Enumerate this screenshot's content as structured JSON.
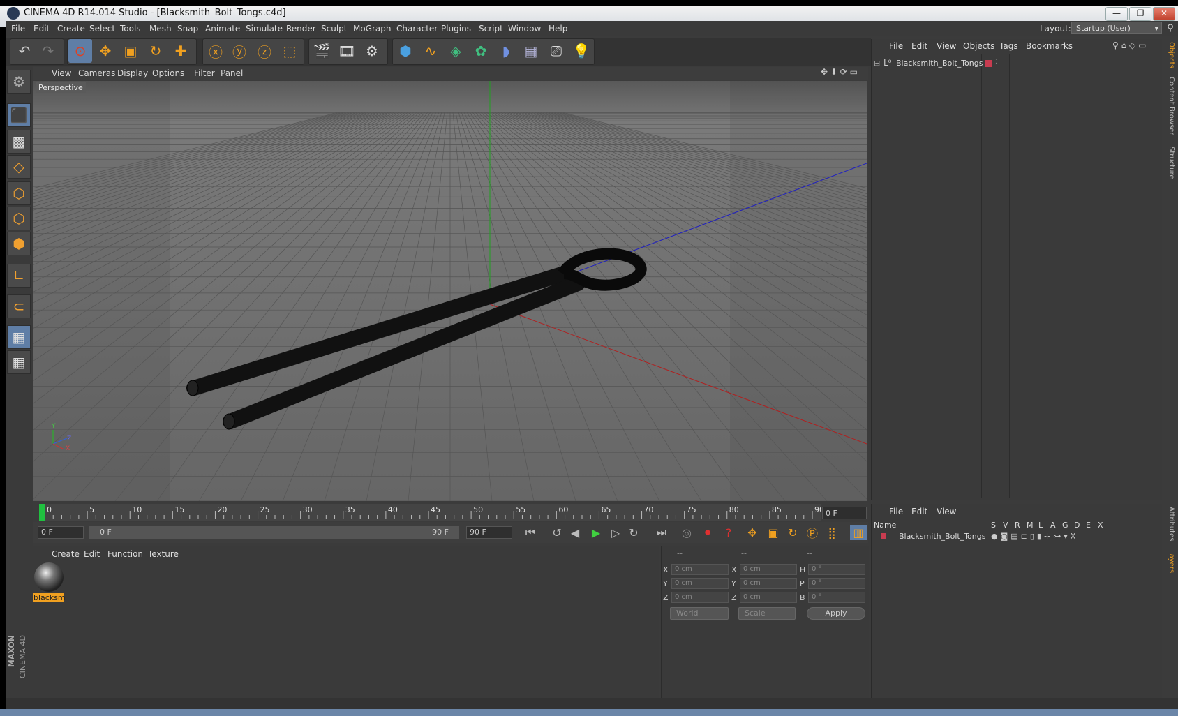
{
  "window": {
    "title": "CINEMA 4D R14.014 Studio - [Blacksmith_Bolt_Tongs.c4d]",
    "minimize": "—",
    "restore": "❐",
    "close": "✕"
  },
  "menubar": {
    "items": [
      "File",
      "Edit",
      "Create",
      "Select",
      "Tools",
      "Mesh",
      "Snap",
      "Animate",
      "Simulate",
      "Render",
      "Sculpt",
      "MoGraph",
      "Character",
      "Plugins",
      "Script",
      "Window",
      "Help"
    ],
    "layout_label": "Layout:",
    "layout_value": "Startup (User)"
  },
  "toolbar": {
    "icons": [
      "undo-icon",
      "redo-icon",
      "select-icon",
      "move-icon",
      "scale-icon",
      "rotate-icon",
      "add-icon",
      "x-axis-icon",
      "y-axis-icon",
      "z-axis-icon",
      "coordinate-system-icon",
      "render-view-icon",
      "render-picture-viewer-icon",
      "edit-render-settings-icon",
      "cube-icon",
      "spline-icon",
      "nurbs-icon",
      "mograph-cloner-icon",
      "deformer-icon",
      "floor-icon",
      "camera-icon",
      "light-icon"
    ]
  },
  "viewport": {
    "menu": [
      "View",
      "Cameras",
      "Display",
      "Options",
      "Filter",
      "Panel"
    ],
    "label": "Perspective",
    "axis_y": "Y",
    "axis_x": "X",
    "axis_z": "Z"
  },
  "timeline": {
    "ticks": [
      "0",
      "5",
      "10",
      "15",
      "20",
      "25",
      "30",
      "35",
      "40",
      "45",
      "50",
      "55",
      "60",
      "65",
      "70",
      "75",
      "80",
      "85",
      "90"
    ],
    "current_frame": "0 F",
    "start_field": "0 F",
    "range_start": "0 F",
    "range_end": "90 F",
    "end_field": "90 F"
  },
  "material_manager": {
    "menu": [
      "Create",
      "Edit",
      "Function",
      "Texture"
    ],
    "material_name": "blacksm"
  },
  "coordinates": {
    "headers": [
      "--",
      "--",
      "--"
    ],
    "rows": [
      {
        "a": "X",
        "av": "0 cm",
        "b": "X",
        "bv": "0 cm",
        "c": "H",
        "cv": "0 °"
      },
      {
        "a": "Y",
        "av": "0 cm",
        "b": "Y",
        "bv": "0 cm",
        "c": "P",
        "cv": "0 °"
      },
      {
        "a": "Z",
        "av": "0 cm",
        "b": "Z",
        "bv": "0 cm",
        "c": "B",
        "cv": "0 °"
      }
    ],
    "mode1": "World",
    "mode2": "Scale",
    "apply": "Apply"
  },
  "objects_panel": {
    "menu": [
      "File",
      "Edit",
      "View",
      "Objects",
      "Tags",
      "Bookmarks"
    ],
    "object_name": "Blacksmith_Bolt_Tongs",
    "side_tabs": [
      "Objects",
      "Content Browser",
      "Structure"
    ]
  },
  "layers_panel": {
    "menu": [
      "File",
      "Edit",
      "View"
    ],
    "col_name": "Name",
    "columns": [
      "S",
      "V",
      "R",
      "M",
      "L",
      "A",
      "G",
      "D",
      "E",
      "X"
    ],
    "layer_name": "Blacksmith_Bolt_Tongs",
    "side_tabs": [
      "Attributes",
      "Layers"
    ]
  },
  "brand": {
    "line1": "MAXON",
    "line2": "CINEMA 4D"
  },
  "colors": {
    "accent": "#f0a020",
    "viewport": "#6f6f6f",
    "panel": "#3a3a3a",
    "x_axis": "#b02020",
    "y_axis": "#20a020",
    "z_axis": "#2020c0",
    "layer_color": "#c83c50"
  }
}
